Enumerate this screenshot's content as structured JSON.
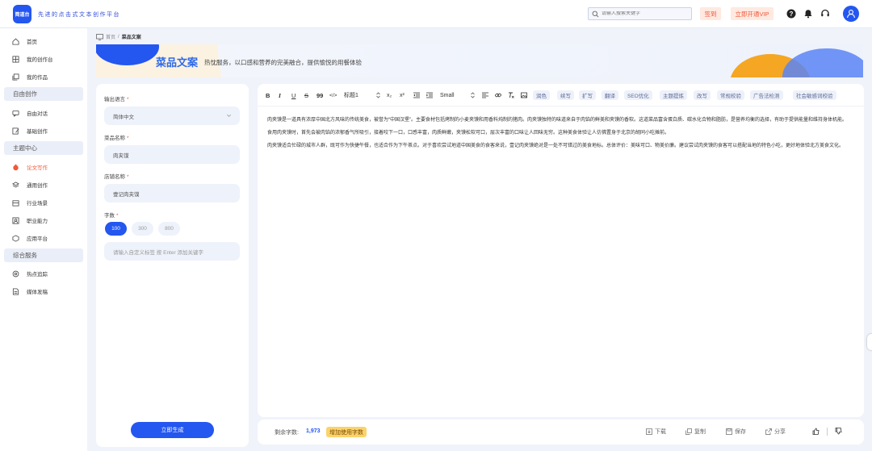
{
  "header": {
    "logo_text": "简道台",
    "slogan": "先进的点击式文本创作平台",
    "search_placeholder": "请输入搜索关键字",
    "signin_label": "签到",
    "vip_label": "立即开通VIP"
  },
  "sidebar": {
    "items_top": [
      {
        "label": "首页",
        "icon": "home-icon"
      },
      {
        "label": "我的创作台",
        "icon": "workspace-icon"
      },
      {
        "label": "我的作品",
        "icon": "works-icon"
      }
    ],
    "group_free": "自由创作",
    "items_free": [
      {
        "label": "自由对话",
        "icon": "chat-icon"
      },
      {
        "label": "基础创作",
        "icon": "edit-icon"
      }
    ],
    "group_theme": "主题中心",
    "items_theme": [
      {
        "label": "论文写作",
        "icon": "paper-icon",
        "active": true
      },
      {
        "label": "通用创作",
        "icon": "layers-icon"
      },
      {
        "label": "行业场景",
        "icon": "industry-icon"
      },
      {
        "label": "职业能力",
        "icon": "career-icon"
      },
      {
        "label": "应用平台",
        "icon": "platform-icon"
      }
    ],
    "group_service": "综合服务",
    "items_service": [
      {
        "label": "热点追踪",
        "icon": "hot-icon"
      },
      {
        "label": "媒体发稿",
        "icon": "media-icon"
      }
    ]
  },
  "breadcrumb": {
    "home": "首页",
    "sep": "/",
    "current": "菜品文案"
  },
  "banner": {
    "title": "菜品文案",
    "subtitle": "热忱服务，以口感和营养的完美融合，提供愉悦的用餐体验"
  },
  "form": {
    "language_label": "输出语言",
    "language_value": "简体中文",
    "dish_label": "菜品名称",
    "dish_value": "肉夹馍",
    "shop_label": "店铺名称",
    "shop_value": "壹记肉夹馍",
    "count_label": "字数",
    "counts": [
      "100",
      "300",
      "800"
    ],
    "selected_count": "100",
    "keyword_placeholder": "请输入自定义标签 按 Enter 添加关键字",
    "generate_label": "立即生成",
    "required_mark": "*"
  },
  "toolbar": {
    "bold": "B",
    "italic": "I",
    "underline": "U",
    "strike": "S",
    "quote": "99",
    "code": "</>",
    "heading": "标题1",
    "sub": "x₂",
    "sup": "x²",
    "size": "Small",
    "chips": [
      "润色",
      "续写",
      "扩写",
      "翻译",
      "SEO优化",
      "主题提炼",
      "改写",
      "常规校验",
      "广告法检测",
      "社会敏感词校验"
    ]
  },
  "editor": {
    "paragraphs": [
      "肉夹馍是一道具有浓厚中国北方风味的传统美食，被誉为“中国汉堡”。主要食材包括烤制的小麦夹馍和用香料炖制的猪肉。肉夹馍独特的味道来自于肉馅的鲜美和夹馍的香软。这道菜品富含蛋白质、碳水化合物和脂肪，是营养均衡的选择，有助于提供能量和维持身体机能。",
      "食用肉夹馍时，首先会被肉馅的浓郁香气所吸引，接着咬下一口，口感丰富，肉质鲜嫩，夹馍松软可口，层次丰富的口味让人回味无穷。这种美食体验让人仿佛置身于北京的胡同小吃摊前。",
      "肉夹馍适合忙碌的城市人群，既可作为快捷午餐，也适合作为下午茶点。对于喜欢尝试地道中国美食的食客来说，壹记肉夹馍绝对是一处不可错过的美食地标。总体评价：美味可口、物美价廉。建议尝试肉夹馍的食客可以搭配当地的特色小吃，更好地体验北方美食文化。"
    ]
  },
  "footer": {
    "remain_label": "剩余字数:",
    "remain_count": "1,973",
    "add_words_label": "增加使用字数",
    "download": "下载",
    "copy": "复制",
    "save": "保存",
    "share": "分享"
  },
  "colors": {
    "accent": "#2456f0",
    "danger": "#f0593b",
    "gold": "#fbd36b"
  }
}
